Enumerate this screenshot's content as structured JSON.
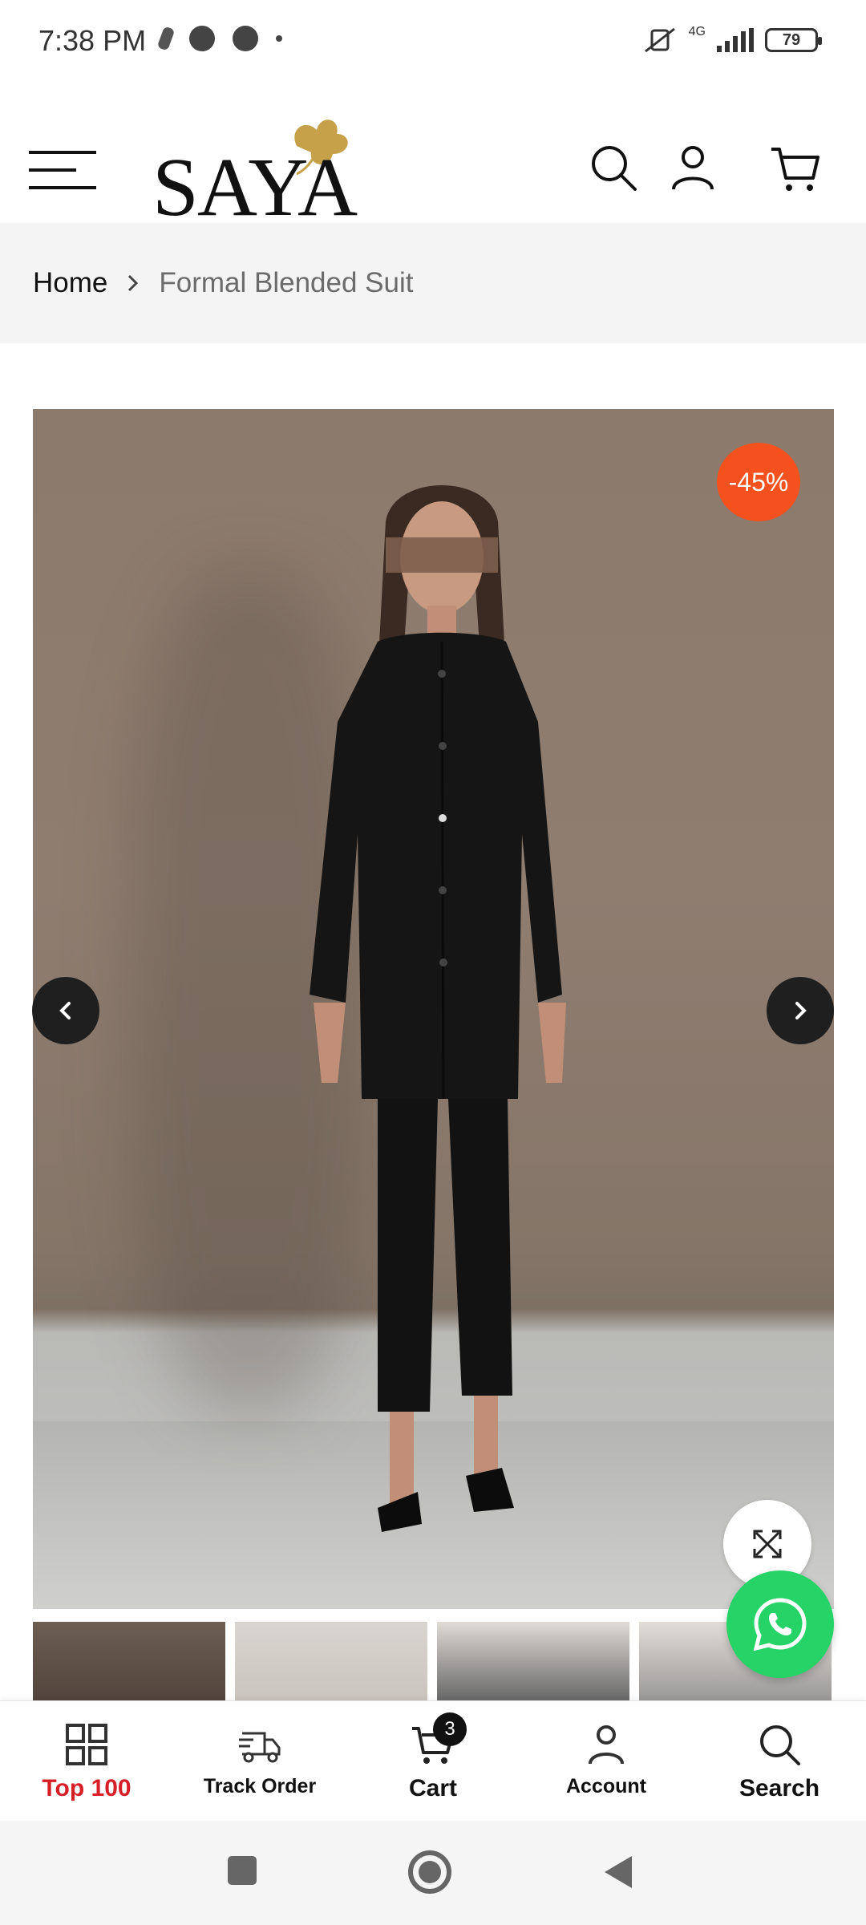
{
  "status_bar": {
    "time": "7:38 PM",
    "network": "4G",
    "battery": "79"
  },
  "header": {
    "logo_text": "SAYA"
  },
  "breadcrumb": {
    "home": "Home",
    "current": "Formal Blended Suit"
  },
  "product": {
    "discount": "-45%"
  },
  "bottom_nav": {
    "items": [
      {
        "label": "Top 100",
        "icon": "grid-icon"
      },
      {
        "label": "Track Order",
        "icon": "truck-icon"
      },
      {
        "label": "Cart",
        "icon": "cart-icon"
      },
      {
        "label": "Account",
        "icon": "user-icon"
      },
      {
        "label": "Search",
        "icon": "search-icon"
      }
    ],
    "cart_count": "3"
  },
  "colors": {
    "accent": "#d61f26",
    "badge": "#f4511e",
    "whatsapp": "#25d366"
  }
}
